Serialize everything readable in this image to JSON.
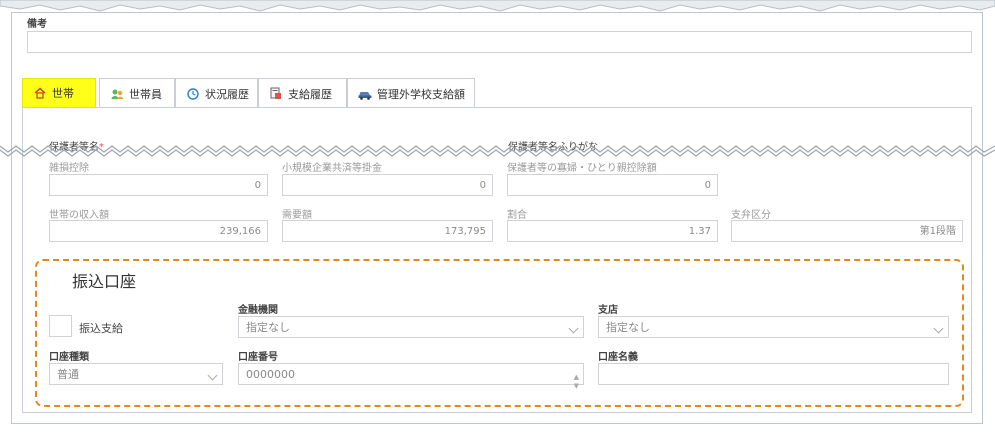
{
  "remarks": {
    "label": "備考",
    "value": ""
  },
  "tabs": [
    {
      "label": "世帯",
      "icon": "home-icon"
    },
    {
      "label": "世帯員",
      "icon": "people-icon"
    },
    {
      "label": "状況履歴",
      "icon": "clock-icon"
    },
    {
      "label": "支給履歴",
      "icon": "document-icon"
    },
    {
      "label": "管理外学校支給額",
      "icon": "car-icon"
    }
  ],
  "guardian": {
    "name_label": "保護者等名",
    "name_required_mark": "*",
    "kana_label": "保護者等名ふりがな"
  },
  "deductions": {
    "disaster_label": "雑損控除",
    "disaster_value": "0",
    "small_biz_label": "小規模企業共済等掛金",
    "small_biz_value": "0",
    "widow_label": "保護者等の寡婦・ひとり親控除額",
    "widow_value": "0"
  },
  "income": {
    "household_income_label": "世帯の収入額",
    "household_income_value": "239,166",
    "demand_label": "需要額",
    "demand_value": "173,795",
    "ratio_label": "割合",
    "ratio_value": "1.37",
    "category_label": "支弁区分",
    "category_value": "第1段階"
  },
  "bank": {
    "section_title": "振込口座",
    "transfer_checkbox_label": "振込支給",
    "institution_label": "金融機関",
    "institution_value": "指定なし",
    "branch_label": "支店",
    "branch_value": "指定なし",
    "account_type_label": "口座種類",
    "account_type_value": "普通",
    "account_number_label": "口座番号",
    "account_number_value": "0000000",
    "account_name_label": "口座名義",
    "account_name_value": ""
  },
  "colors": {
    "active_tab": "#ffff1a",
    "highlight_border": "#e08a1c"
  }
}
